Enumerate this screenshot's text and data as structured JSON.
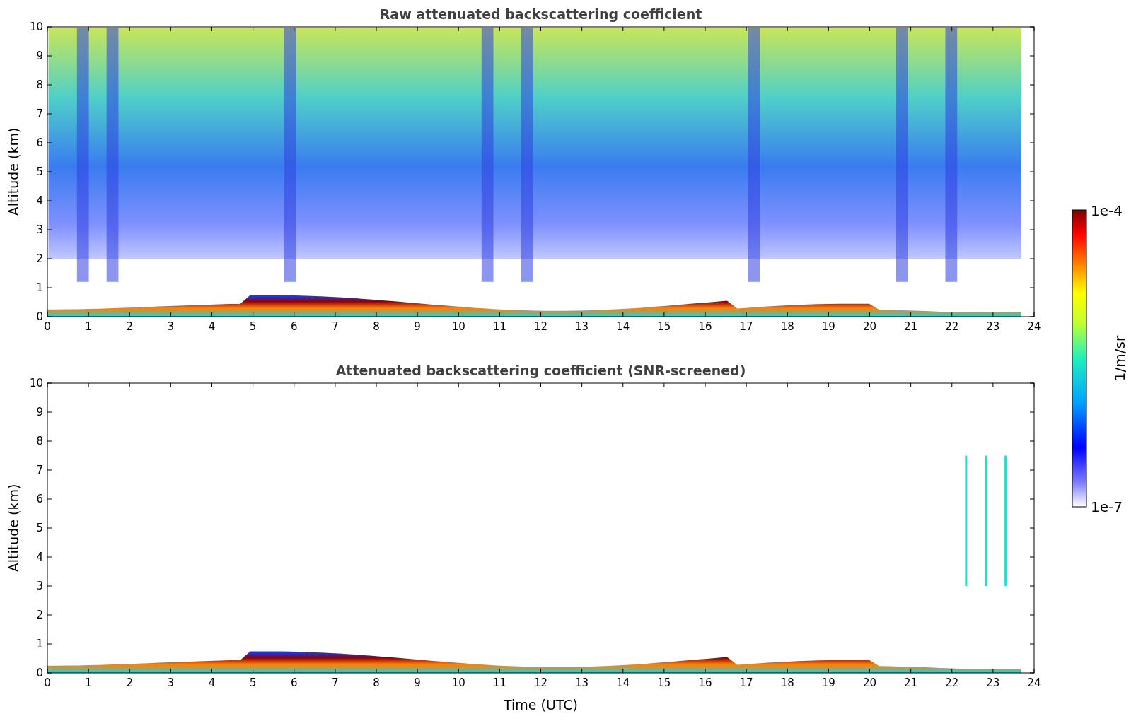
{
  "plots": [
    {
      "kind": "raw",
      "title": "Raw attenuated backscattering coefficient",
      "ylabel": "Altitude (km)",
      "xticks": [
        "0",
        "1",
        "2",
        "3",
        "4",
        "5",
        "6",
        "7",
        "8",
        "9",
        "10",
        "11",
        "12",
        "13",
        "14",
        "15",
        "16",
        "17",
        "18",
        "19",
        "20",
        "21",
        "22",
        "23",
        "24"
      ],
      "yticks": [
        "10",
        "9",
        "8",
        "7",
        "6",
        "5",
        "4",
        "3",
        "2",
        "1",
        "0"
      ]
    },
    {
      "kind": "screened",
      "title": "Attenuated backscattering coefficient (SNR-screened)",
      "ylabel": "Altitude (km)",
      "xlabel": "Time (UTC)",
      "xticks": [
        "0",
        "1",
        "2",
        "3",
        "4",
        "5",
        "6",
        "7",
        "8",
        "9",
        "10",
        "11",
        "12",
        "13",
        "14",
        "15",
        "16",
        "17",
        "18",
        "19",
        "20",
        "21",
        "22",
        "23",
        "24"
      ],
      "yticks": [
        "10",
        "9",
        "8",
        "7",
        "6",
        "5",
        "4",
        "3",
        "2",
        "1",
        "0"
      ]
    }
  ],
  "colorbar": {
    "max_label": "1e-4",
    "min_label": "1e-7",
    "label": "1/m/sr"
  }
}
